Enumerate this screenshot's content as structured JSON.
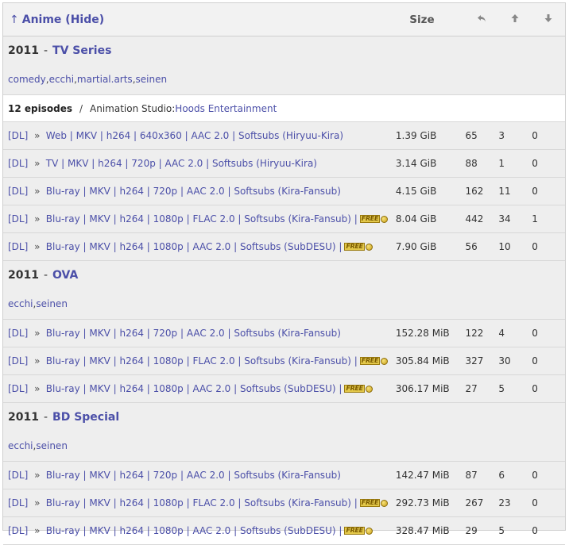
{
  "header": {
    "arrow": "↑",
    "title": "Anime",
    "hide_open": "(",
    "hide_label": "Hide",
    "hide_close": ")",
    "size_label": "Size",
    "icons": [
      "reply-icon",
      "arrow-up-icon",
      "arrow-down-icon"
    ]
  },
  "free_label": "FREE",
  "groups": [
    {
      "year": "2011",
      "type": "TV Series",
      "tags": [
        "comedy",
        "ecchi",
        "martial.arts",
        "seinen"
      ],
      "info": {
        "episodes": "12 episodes",
        "studio_label": "Animation Studio:",
        "studio": "Hoods Entertainment"
      },
      "rows": [
        {
          "dl": "[DL]",
          "desc": "Web | MKV | h264 | 640x360 | AAC 2.0 | Softsubs (Hiryuu-Kira)",
          "free": false,
          "size": "1.39 GiB",
          "a": "65",
          "b": "3",
          "c": "0"
        },
        {
          "dl": "[DL]",
          "desc": "TV | MKV | h264 | 720p | AAC 2.0 | Softsubs (Hiryuu-Kira)",
          "free": false,
          "size": "3.14 GiB",
          "a": "88",
          "b": "1",
          "c": "0"
        },
        {
          "dl": "[DL]",
          "desc": "Blu-ray | MKV | h264 | 720p | AAC 2.0 | Softsubs (Kira-Fansub)",
          "free": false,
          "size": "4.15 GiB",
          "a": "162",
          "b": "11",
          "c": "0"
        },
        {
          "dl": "[DL]",
          "desc": "Blu-ray | MKV | h264 | 1080p | FLAC 2.0 | Softsubs (Kira-Fansub) |",
          "free": true,
          "size": "8.04 GiB",
          "a": "442",
          "b": "34",
          "c": "1"
        },
        {
          "dl": "[DL]",
          "desc": "Blu-ray | MKV | h264 | 1080p | AAC 2.0 | Softsubs (SubDESU) |",
          "free": true,
          "size": "7.90 GiB",
          "a": "56",
          "b": "10",
          "c": "0"
        }
      ]
    },
    {
      "year": "2011",
      "type": "OVA",
      "tags": [
        "ecchi",
        "seinen"
      ],
      "rows": [
        {
          "dl": "[DL]",
          "desc": "Blu-ray | MKV | h264 | 720p | AAC 2.0 | Softsubs (Kira-Fansub)",
          "free": false,
          "size": "152.28 MiB",
          "a": "122",
          "b": "4",
          "c": "0"
        },
        {
          "dl": "[DL]",
          "desc": "Blu-ray | MKV | h264 | 1080p | FLAC 2.0 | Softsubs (Kira-Fansub) |",
          "free": true,
          "size": "305.84 MiB",
          "a": "327",
          "b": "30",
          "c": "0"
        },
        {
          "dl": "[DL]",
          "desc": "Blu-ray | MKV | h264 | 1080p | AAC 2.0 | Softsubs (SubDESU) |",
          "free": true,
          "size": "306.17 MiB",
          "a": "27",
          "b": "5",
          "c": "0"
        }
      ]
    },
    {
      "year": "2011",
      "type": "BD Special",
      "tags": [
        "ecchi",
        "seinen"
      ],
      "rows": [
        {
          "dl": "[DL]",
          "desc": "Blu-ray | MKV | h264 | 720p | AAC 2.0 | Softsubs (Kira-Fansub)",
          "free": false,
          "size": "142.47 MiB",
          "a": "87",
          "b": "6",
          "c": "0"
        },
        {
          "dl": "[DL]",
          "desc": "Blu-ray | MKV | h264 | 1080p | FLAC 2.0 | Softsubs (Kira-Fansub) |",
          "free": true,
          "size": "292.73 MiB",
          "a": "267",
          "b": "23",
          "c": "0"
        },
        {
          "dl": "[DL]",
          "desc": "Blu-ray | MKV | h264 | 1080p | AAC 2.0 | Softsubs (SubDESU) |",
          "free": true,
          "size": "328.47 MiB",
          "a": "29",
          "b": "5",
          "c": "0"
        }
      ]
    }
  ]
}
